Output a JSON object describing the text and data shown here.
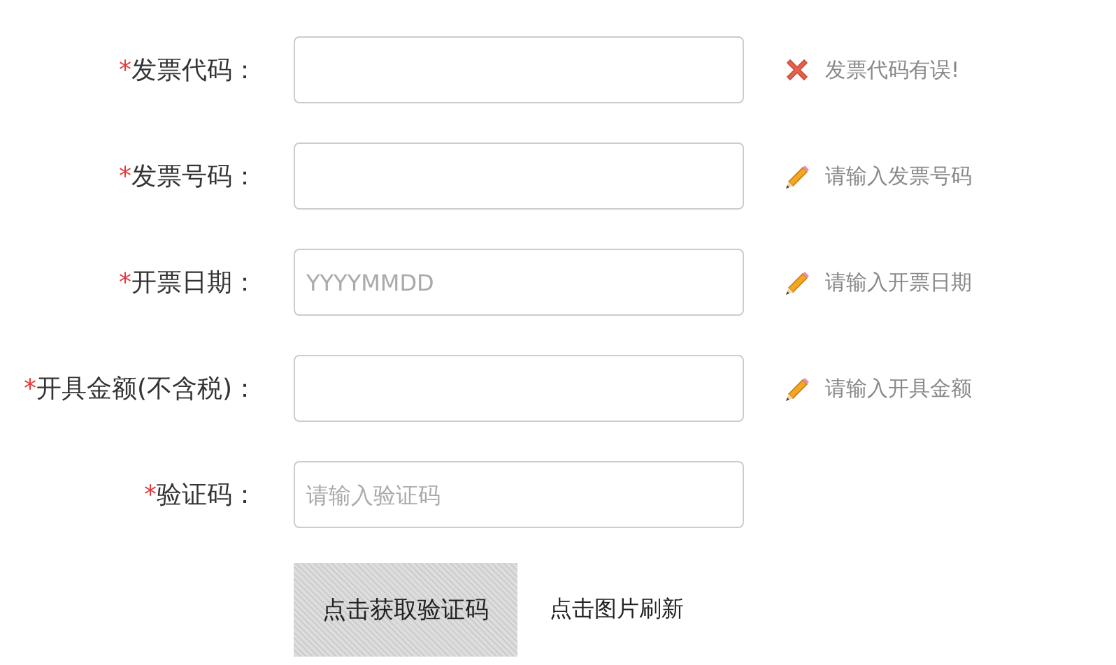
{
  "fields": [
    {
      "required_mark": "*",
      "label": "发票代码：",
      "message": {
        "kind": "error",
        "text": "发票代码有误!"
      }
    },
    {
      "required_mark": "*",
      "label": "发票号码：",
      "message": {
        "kind": "hint",
        "text": "请输入发票号码"
      }
    },
    {
      "required_mark": "*",
      "label": "开票日期：",
      "placeholder": "YYYYMMDD",
      "message": {
        "kind": "hint",
        "text": "请输入开票日期"
      }
    },
    {
      "required_mark": "*",
      "label": "开具金额(不含税)：",
      "message": {
        "kind": "hint",
        "text": "请输入开具金额"
      }
    },
    {
      "required_mark": "*",
      "label": "验证码：",
      "placeholder": "请输入验证码"
    }
  ],
  "captcha": {
    "image_text": "点击获取验证码",
    "refresh_text": "点击图片刷新"
  }
}
